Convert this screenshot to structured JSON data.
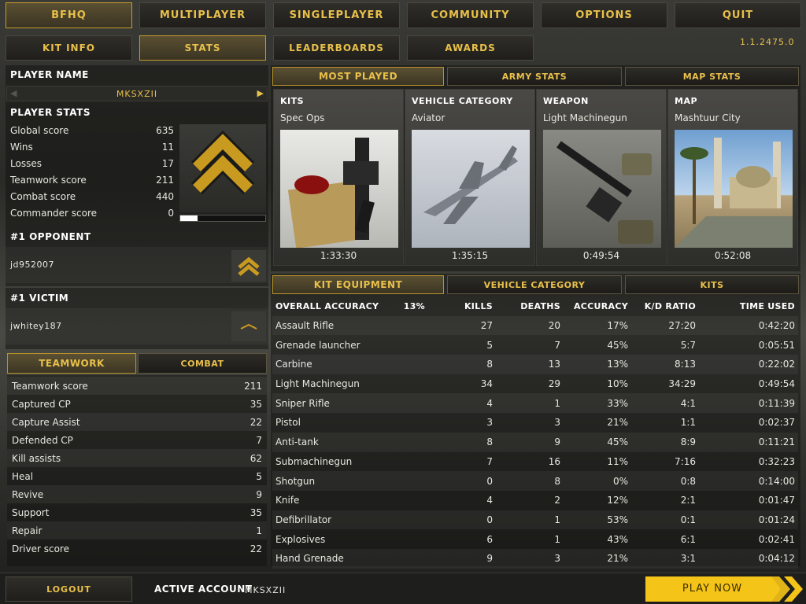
{
  "top_nav": [
    "BFHQ",
    "MULTIPLAYER",
    "SINGLEPLAYER",
    "COMMUNITY",
    "OPTIONS",
    "QUIT"
  ],
  "sub_nav": [
    "KIT INFO",
    "STATS",
    "LEADERBOARDS",
    "AWARDS"
  ],
  "version": "1.1.2475.0",
  "player": {
    "name_label": "PLAYER NAME",
    "name": "MKSXZII",
    "stats_label": "PLAYER STATS",
    "stats": [
      {
        "label": "Global score",
        "value": "635"
      },
      {
        "label": "Wins",
        "value": "11"
      },
      {
        "label": "Losses",
        "value": "17"
      },
      {
        "label": "Teamwork score",
        "value": "211"
      },
      {
        "label": "Combat score",
        "value": "440"
      },
      {
        "label": "Commander score",
        "value": "0"
      }
    ],
    "rank_progress": 0.2
  },
  "opponent": {
    "label": "#1 OPPONENT",
    "name": "jd952007"
  },
  "victim": {
    "label": "#1 VICTIM",
    "name": "jwhitey187"
  },
  "score_tabs": [
    "TEAMWORK",
    "COMBAT"
  ],
  "teamwork": [
    {
      "label": "Teamwork score",
      "value": "211"
    },
    {
      "label": "Captured CP",
      "value": "35"
    },
    {
      "label": "Capture Assist",
      "value": "22"
    },
    {
      "label": "Defended CP",
      "value": "7"
    },
    {
      "label": "Kill assists",
      "value": "62"
    },
    {
      "label": "Heal",
      "value": "5"
    },
    {
      "label": "Revive",
      "value": "9"
    },
    {
      "label": "Support",
      "value": "35"
    },
    {
      "label": "Repair",
      "value": "1"
    },
    {
      "label": "Driver score",
      "value": "22"
    }
  ],
  "top_tabs": [
    "MOST PLAYED",
    "ARMY STATS",
    "MAP STATS"
  ],
  "most_played": [
    {
      "title": "KITS",
      "value": "Spec Ops",
      "time": "1:33:30"
    },
    {
      "title": "VEHICLE CATEGORY",
      "value": "Aviator",
      "time": "1:35:15"
    },
    {
      "title": "WEAPON",
      "value": "Light Machinegun",
      "time": "0:49:54"
    },
    {
      "title": "MAP",
      "value": "Mashtuur City",
      "time": "0:52:08"
    }
  ],
  "bottom_tabs": [
    "KIT EQUIPMENT",
    "VEHICLE CATEGORY",
    "KITS"
  ],
  "equipment": {
    "headers": [
      "OVERALL ACCURACY",
      "13%",
      "KILLS",
      "DEATHS",
      "ACCURACY",
      "K/D RATIO",
      "TIME USED"
    ],
    "rows": [
      [
        "Assault Rifle",
        "",
        "27",
        "20",
        "17%",
        "27:20",
        "0:42:20"
      ],
      [
        "Grenade launcher",
        "",
        "5",
        "7",
        "45%",
        "5:7",
        "0:05:51"
      ],
      [
        "Carbine",
        "",
        "8",
        "13",
        "13%",
        "8:13",
        "0:22:02"
      ],
      [
        "Light Machinegun",
        "",
        "34",
        "29",
        "10%",
        "34:29",
        "0:49:54"
      ],
      [
        "Sniper Rifle",
        "",
        "4",
        "1",
        "33%",
        "4:1",
        "0:11:39"
      ],
      [
        "Pistol",
        "",
        "3",
        "3",
        "21%",
        "1:1",
        "0:02:37"
      ],
      [
        "Anti-tank",
        "",
        "8",
        "9",
        "45%",
        "8:9",
        "0:11:21"
      ],
      [
        "Submachinegun",
        "",
        "7",
        "16",
        "11%",
        "7:16",
        "0:32:23"
      ],
      [
        "Shotgun",
        "",
        "0",
        "8",
        "0%",
        "0:8",
        "0:14:00"
      ],
      [
        "Knife",
        "",
        "4",
        "2",
        "12%",
        "2:1",
        "0:01:47"
      ],
      [
        "Defibrillator",
        "",
        "0",
        "1",
        "53%",
        "0:1",
        "0:01:24"
      ],
      [
        "Explosives",
        "",
        "6",
        "1",
        "43%",
        "6:1",
        "0:02:41"
      ],
      [
        "Hand Grenade",
        "",
        "9",
        "3",
        "21%",
        "3:1",
        "0:04:12"
      ]
    ]
  },
  "footer": {
    "logout": "LOGOUT",
    "account_label": "ACTIVE ACCOUNT",
    "account": "MKSXZII",
    "play": "PLAY NOW"
  },
  "colors": {
    "accent": "#e8c04a",
    "play": "#f5c418"
  }
}
